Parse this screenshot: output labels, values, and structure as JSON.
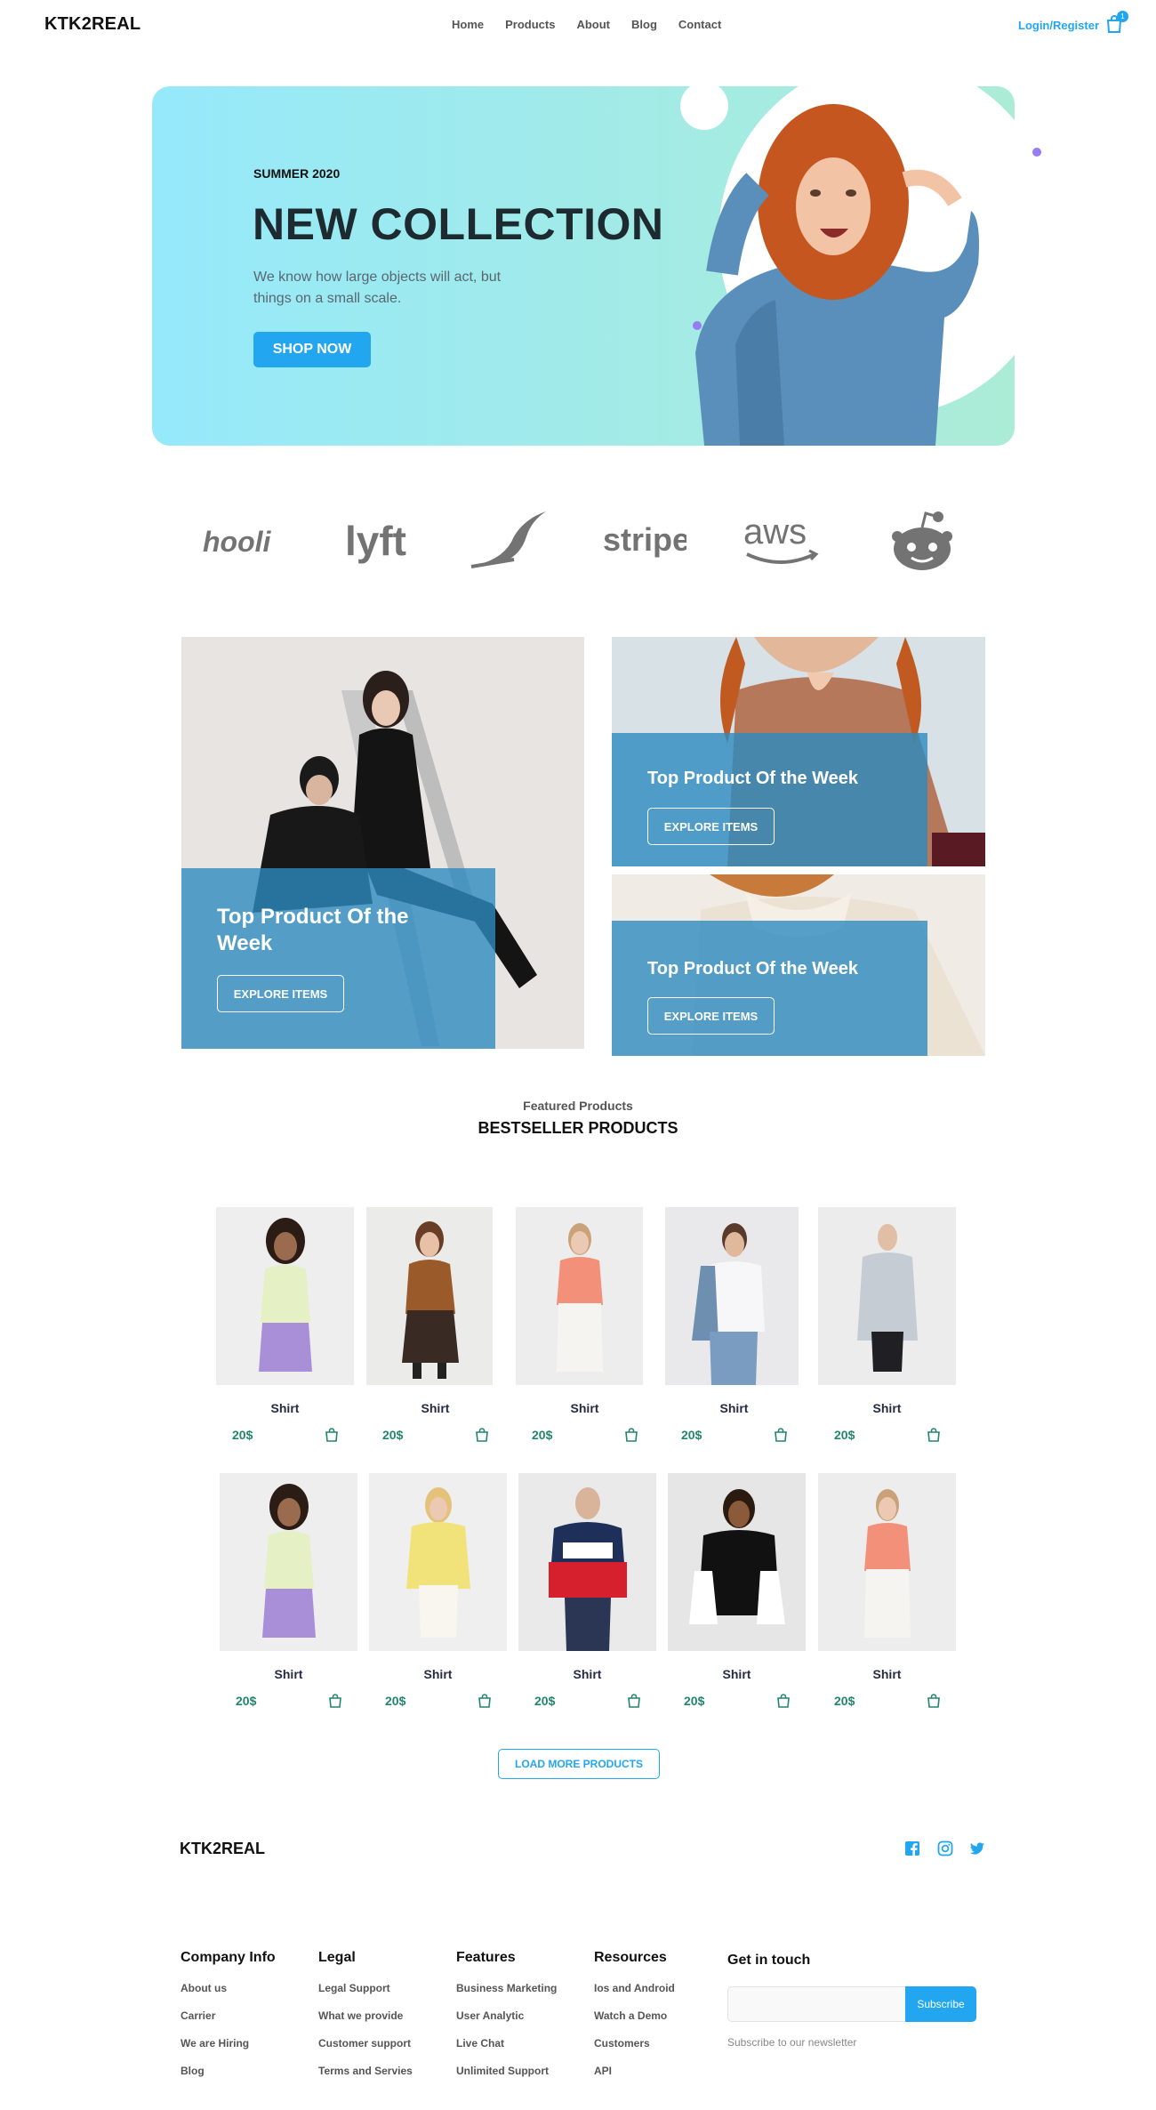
{
  "nav": {
    "logo": "KTK2REAL",
    "links": [
      "Home",
      "Products",
      "About",
      "Blog",
      "Contact"
    ],
    "login": "Login/Register",
    "cart_count": "1",
    "cart_icon": "shopping-bag-icon"
  },
  "hero": {
    "eyebrow": "SUMMER 2020",
    "title": "NEW COLLECTION",
    "description": "We know how large objects will act, but things on a small scale.",
    "cta": "SHOP NOW"
  },
  "brands": [
    "hooli",
    "lyft",
    "feather",
    "stripe",
    "aws",
    "reddit"
  ],
  "tiles": [
    {
      "title": "Top Product Of the Week",
      "button": "EXPLORE ITEMS"
    },
    {
      "title": "Top Product Of the Week",
      "button": "EXPLORE ITEMS"
    },
    {
      "title": "Top Product Of the Week",
      "button": "EXPLORE ITEMS"
    }
  ],
  "featured": {
    "subtitle": "Featured Products",
    "title": "BESTSELLER PRODUCTS"
  },
  "products": [
    {
      "name": "Shirt",
      "price": "20$"
    },
    {
      "name": "Shirt",
      "price": "20$"
    },
    {
      "name": "Shirt",
      "price": "20$"
    },
    {
      "name": "Shirt",
      "price": "20$"
    },
    {
      "name": "Shirt",
      "price": "20$"
    },
    {
      "name": "Shirt",
      "price": "20$"
    },
    {
      "name": "Shirt",
      "price": "20$"
    },
    {
      "name": "Shirt",
      "price": "20$"
    },
    {
      "name": "Shirt",
      "price": "20$"
    },
    {
      "name": "Shirt",
      "price": "20$"
    }
  ],
  "load_more": "LOAD MORE PRODUCTS",
  "footer": {
    "logo": "KTK2REAL",
    "social": [
      "facebook-icon",
      "instagram-icon",
      "twitter-icon"
    ],
    "columns": [
      {
        "title": "Company Info",
        "links": [
          "About us",
          "Carrier",
          "We are Hiring",
          "Blog"
        ]
      },
      {
        "title": "Legal",
        "links": [
          "Legal Support",
          "What we provide",
          "Customer support",
          "Terms and Servies"
        ]
      },
      {
        "title": "Features",
        "links": [
          "Business Marketing",
          "User Analytic",
          "Live Chat",
          "Unlimited Support"
        ]
      },
      {
        "title": "Resources",
        "links": [
          "Ios and Android",
          "Watch a Demo",
          "Customers",
          "API"
        ]
      }
    ],
    "get_in_touch": "Get in touch",
    "email_placeholder": "",
    "subscribe": "Subscribe",
    "subscribe_note": "Subscribe to our newsletter"
  },
  "colors": {
    "primary": "#23a6f0",
    "price": "#23856d",
    "overlay": "#2d8bc0"
  }
}
